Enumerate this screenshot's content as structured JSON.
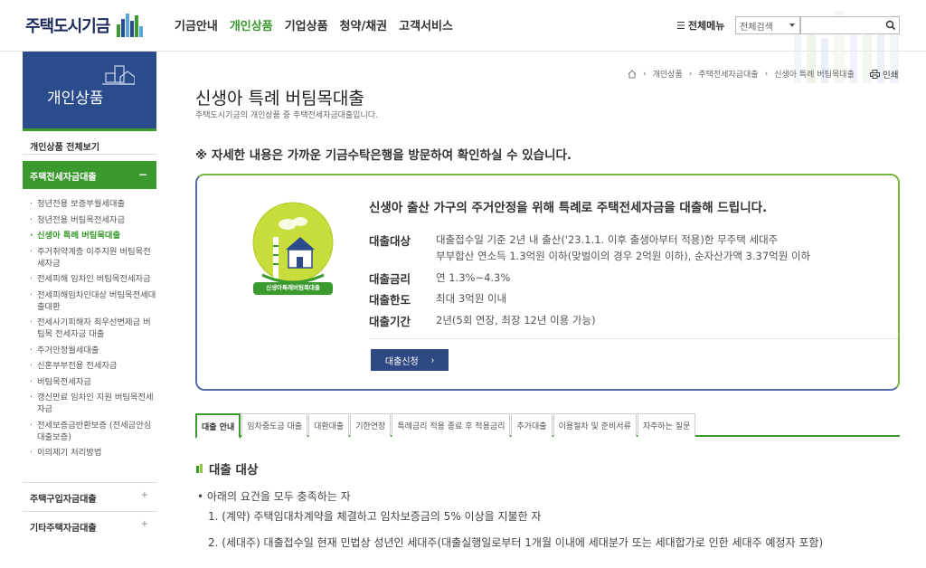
{
  "header": {
    "logo_text": "주택도시기금",
    "nav": [
      "기금안내",
      "개인상품",
      "기업상품",
      "청약/채권",
      "고객서비스"
    ],
    "nav_active_index": 1,
    "all_menu_label": "전체메뉴",
    "search_scope": "전체검색",
    "search_placeholder": ""
  },
  "sidebar": {
    "title": "개인상품",
    "view_all": "개인상품 전체보기",
    "active_group": "주택전세자금대출",
    "active_group_symbol": "−",
    "items": [
      "청년전용 보증부월세대출",
      "청년전용 버팀목전세자금",
      "신생아 특례 버팀목대출",
      "주거취약계층 이주지원 버팀목전세자금",
      "전세피해 임차인 버팀목전세자금",
      "전세피해임차인대상 버팀목전세대출대환",
      "전세사기피해자 최우선변제금 버팀목 전세자금 대출",
      "주거안정월세대출",
      "신혼부부전용 전세자금",
      "버팀목전세자금",
      "갱신만료 임차인 지원 버팀목전세자금",
      "전세보증금반환보증 (전세금안심대출보증)",
      "이의제기 처리방법"
    ],
    "current_index": 2,
    "other_groups": [
      "주택구입자금대출",
      "기타주택자금대출"
    ],
    "other_group_symbol": "+"
  },
  "breadcrumb": [
    "개인상품",
    "주택전세자금대출",
    "신생아 특례 버팀목대출"
  ],
  "print_label": "인쇄",
  "page": {
    "title": "신생아 특례 버팀목대출",
    "subtitle": "주택도시기금의 개인상품 중 주택전세자금대출입니다.",
    "notice": "※ 자세한 내용은 가까운 기금수탁은행을 방문하여 확인하실 수 있습니다."
  },
  "summary": {
    "badge_label": "신생아특례버팀목대출",
    "headline": "신생아 출산 가구의 주거안정을 위해 특례로 주택전세자금을 대출해 드립니다.",
    "rows": [
      {
        "key": "대출대상",
        "value": "대출접수일 기준 2년 내 출산('23.1.1. 이후 출생아부터 적용)한 무주택 세대주",
        "value2": "부부합산 연소득 1.3억원 이하(맞벌이의 경우 2억원 이하), 순자산가액 3.37억원 이하"
      },
      {
        "key": "대출금리",
        "value": "연 1.3%~4.3%"
      },
      {
        "key": "대출한도",
        "value": "최대 3억원 이내"
      },
      {
        "key": "대출기간",
        "value": "2년(5회 연장, 최장 12년 이용 가능)"
      }
    ],
    "apply_label": "대출신청"
  },
  "tabs": [
    "대출 안내",
    "임차중도금 대출",
    "대환대출",
    "기한연장",
    "특례금리 적용 종료 후 적용금리",
    "추가대출",
    "이용절차 및 준비서류",
    "자주하는 질문"
  ],
  "tab_active_index": 0,
  "content": {
    "section_title": "대출 대상",
    "bullet": "• 아래의 요건을 모두 충족하는 자",
    "items": [
      "1. (계약) 주택임대차계약을 체결하고 임차보증금의 5% 이상을 지불한 자",
      "2. (세대주) 대출접수일 현재 민법상 성년인 세대주(대출실행일로부터 1개월 이내에 세대분가 또는 세대합가로 인한 세대주 예정자 포함)"
    ]
  },
  "colors": {
    "brand_green": "#3a9a2e",
    "brand_navy": "#2b4c8c",
    "button_navy": "#2f4a82"
  }
}
